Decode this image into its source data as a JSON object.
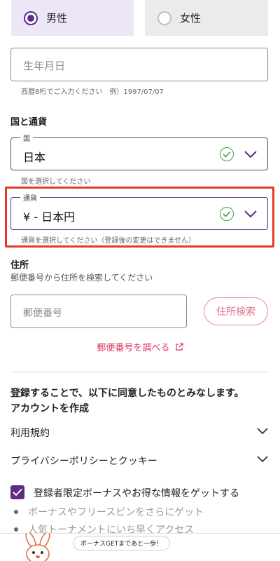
{
  "gender": {
    "male_label": "男性",
    "female_label": "女性",
    "selected": "男性"
  },
  "birthdate": {
    "placeholder": "生年月日",
    "hint": "西暦8桁でご入力ください　例）1997/07/07"
  },
  "country_currency": {
    "section_title": "国と通貨",
    "country": {
      "legend": "国",
      "value": "日本",
      "hint": "国を選択してください"
    },
    "currency": {
      "legend": "通貨",
      "value": "¥ - 日本円",
      "hint": "通貨を選択してください（登録後の変更はできません）"
    }
  },
  "address": {
    "section_title": "住所",
    "subtitle": "郵便番号から住所を検索してください",
    "zip_placeholder": "郵便番号",
    "search_button": "住所検索",
    "lookup_link": "郵便番号を調べる"
  },
  "agreement": {
    "line1": "登録することで、以下に同意したものとみなします。",
    "line2": "アカウントを作成",
    "terms": "利用規約",
    "privacy": "プライバシーポリシーとクッキー"
  },
  "newsletter": {
    "label": "登録者限定ボーナスやお得な情報をゲットする",
    "checked": true,
    "bullets": [
      "ボーナスやフリースピンをさらにゲット",
      "人気トーナメントにいち早くアクセス"
    ]
  },
  "banner": {
    "bubble_text": "ボーナスGETまであと一歩！"
  },
  "colors": {
    "accent": "#5b2b86",
    "success": "#43a047",
    "highlight": "#e53a2b",
    "link": "#d8385e"
  }
}
